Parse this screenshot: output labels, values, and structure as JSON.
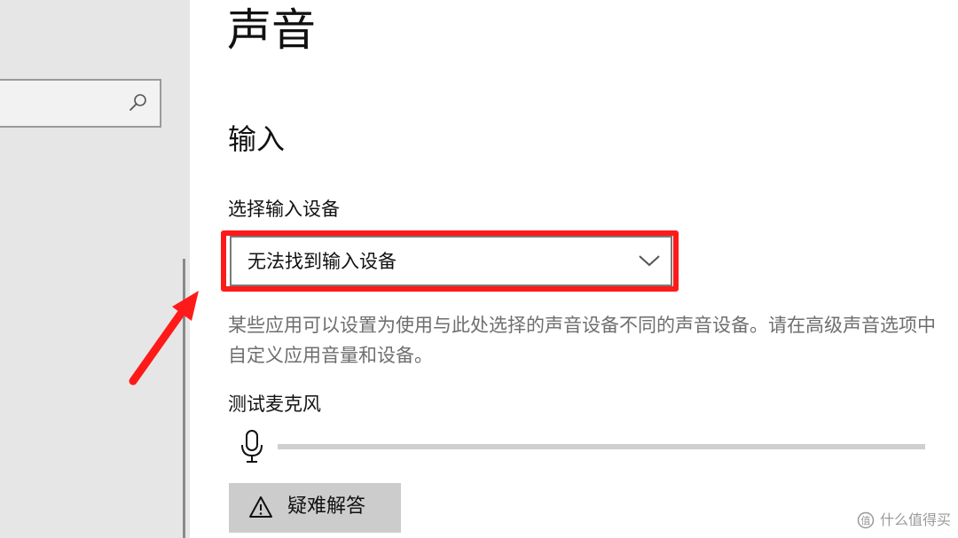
{
  "page": {
    "title": "声音"
  },
  "sidebar": {
    "search": {
      "value": "",
      "placeholder": "",
      "icon": "search-icon"
    }
  },
  "input_section": {
    "title": "输入",
    "device_label": "选择输入设备",
    "device_select": {
      "value": "无法找到输入设备",
      "icon": "chevron-down-icon"
    },
    "description": "某些应用可以设置为使用与此处选择的声音设备不同的声音设备。请在高级声音选项中自定义应用音量和设备。",
    "mic_test": {
      "label": "测试麦克风",
      "icon": "microphone-icon",
      "level": 0
    },
    "troubleshoot_button": {
      "label": "疑难解答",
      "icon": "warning-icon"
    }
  },
  "annotation": {
    "highlight_color": "#ff1a1a",
    "arrow_color": "#ff1a1a"
  },
  "watermark": {
    "text": "什么值得买"
  },
  "colors": {
    "accent": "#0078d7",
    "sidebar_bg": "#e6e6e6",
    "secondary_text": "#6e6e6e",
    "button_bg": "#cccccc"
  }
}
